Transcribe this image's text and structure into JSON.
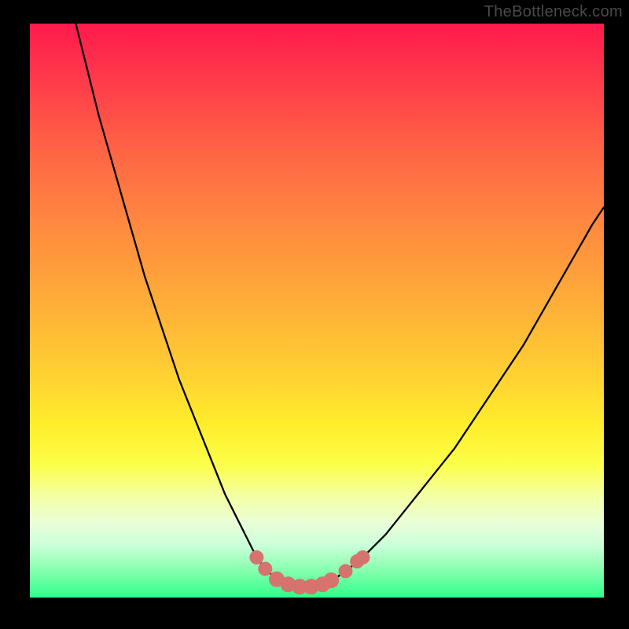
{
  "watermark": "TheBottleneck.com",
  "chart_data": {
    "type": "line",
    "title": "",
    "xlabel": "",
    "ylabel": "",
    "xlim": [
      0,
      100
    ],
    "ylim": [
      0,
      100
    ],
    "series": [
      {
        "name": "bottleneck-curve",
        "x": [
          8,
          10,
          12,
          14,
          16,
          18,
          20,
          22,
          24,
          26,
          28,
          30,
          32,
          34,
          36,
          38,
          39.5,
          41,
          43,
          45,
          47,
          49,
          51,
          53,
          55,
          58,
          62,
          66,
          70,
          74,
          78,
          82,
          86,
          90,
          94,
          98,
          100
        ],
        "y": [
          100,
          92,
          84,
          77,
          70,
          63,
          56,
          50,
          44,
          38,
          33,
          28,
          23,
          18,
          14,
          10,
          7,
          5,
          3.2,
          2.3,
          1.9,
          1.9,
          2.3,
          3.2,
          4.6,
          7,
          11,
          16,
          21,
          26,
          32,
          38,
          44,
          51,
          58,
          65,
          68
        ]
      }
    ],
    "markers": {
      "name": "highlight-points",
      "color": "#d6736f",
      "points": [
        {
          "x": 39.5,
          "y": 7,
          "r": 9
        },
        {
          "x": 41,
          "y": 5,
          "r": 9
        },
        {
          "x": 43,
          "y": 3.2,
          "r": 10
        },
        {
          "x": 45,
          "y": 2.3,
          "r": 10
        },
        {
          "x": 47,
          "y": 1.9,
          "r": 10
        },
        {
          "x": 49,
          "y": 1.9,
          "r": 10
        },
        {
          "x": 51,
          "y": 2.3,
          "r": 10
        },
        {
          "x": 52.5,
          "y": 3.0,
          "r": 10
        },
        {
          "x": 55,
          "y": 4.6,
          "r": 9
        },
        {
          "x": 57,
          "y": 6.3,
          "r": 9
        },
        {
          "x": 58,
          "y": 7,
          "r": 9
        }
      ]
    }
  }
}
